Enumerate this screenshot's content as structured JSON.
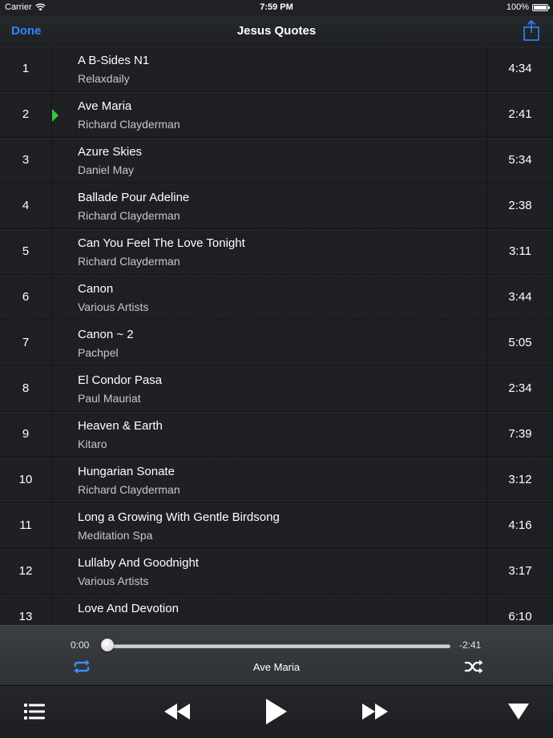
{
  "status_bar": {
    "carrier": "Carrier",
    "time": "7:59 PM",
    "battery": "100%"
  },
  "nav": {
    "done_label": "Done",
    "title": "Jesus Quotes"
  },
  "tracks": [
    {
      "num": "1",
      "title": "A B-Sides N1",
      "artist": "Relaxdaily",
      "duration": "4:34"
    },
    {
      "num": "2",
      "title": "Ave Maria",
      "artist": "Richard Clayderman",
      "duration": "2:41",
      "playing": true
    },
    {
      "num": "3",
      "title": "Azure Skies",
      "artist": "Daniel May",
      "duration": "5:34"
    },
    {
      "num": "4",
      "title": "Ballade Pour Adeline",
      "artist": "Richard Clayderman",
      "duration": "2:38"
    },
    {
      "num": "5",
      "title": "Can You Feel The Love Tonight",
      "artist": "Richard Clayderman",
      "duration": "3:11"
    },
    {
      "num": "6",
      "title": "Canon",
      "artist": "Various Artists",
      "duration": "3:44"
    },
    {
      "num": "7",
      "title": "Canon ~ 2",
      "artist": "Pachpel",
      "duration": "5:05"
    },
    {
      "num": "8",
      "title": "El Condor Pasa",
      "artist": "Paul Mauriat",
      "duration": "2:34"
    },
    {
      "num": "9",
      "title": "Heaven & Earth",
      "artist": "Kitaro",
      "duration": "7:39"
    },
    {
      "num": "10",
      "title": "Hungarian Sonate",
      "artist": "Richard Clayderman",
      "duration": "3:12"
    },
    {
      "num": "11",
      "title": "Long a Growing With Gentle Birdsong",
      "artist": "Meditation Spa",
      "duration": "4:16"
    },
    {
      "num": "12",
      "title": "Lullaby And Goodnight",
      "artist": "Various Artists",
      "duration": "3:17"
    },
    {
      "num": "13",
      "title": "Love And Devotion",
      "artist": "",
      "duration": "6:10"
    }
  ],
  "player": {
    "elapsed": "0:00",
    "remaining": "-2:41",
    "now_playing": "Ave Maria",
    "progress": 0.0
  },
  "colors": {
    "accent": "#2f86ff",
    "playing_indicator": "#2ecc40"
  },
  "icons": {
    "status": [
      "wifi-icon",
      "battery-icon"
    ],
    "nav": [
      "share-icon"
    ],
    "player": [
      "repeat-icon",
      "shuffle-icon"
    ],
    "toolbar": [
      "list-icon",
      "rewind-icon",
      "play-icon",
      "fast-forward-icon",
      "collapse-icon"
    ]
  }
}
